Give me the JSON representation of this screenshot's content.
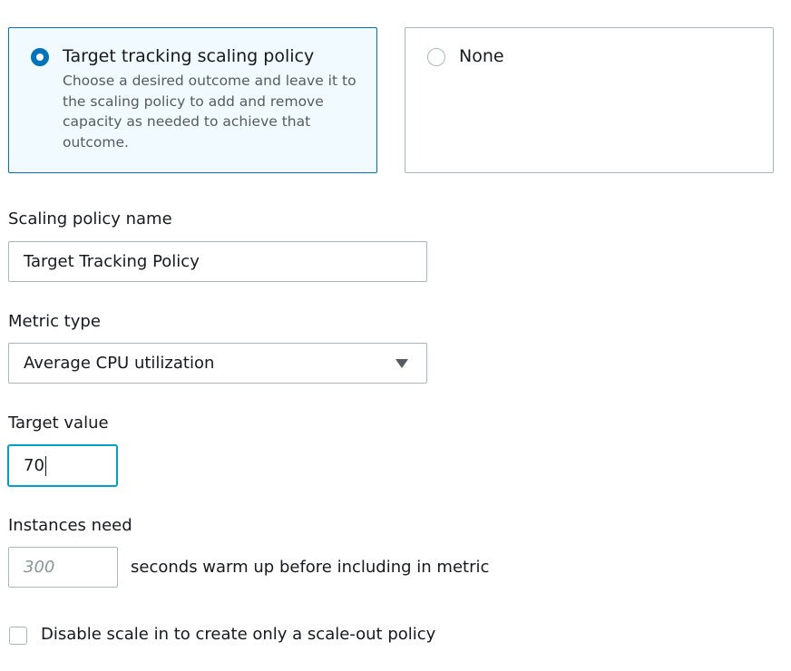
{
  "policy_options": [
    {
      "title": "Target tracking scaling policy",
      "description": "Choose a desired outcome and leave it to the scaling policy to add and remove capacity as needed to achieve that outcome.",
      "selected": true
    },
    {
      "title": "None",
      "selected": false
    }
  ],
  "fields": {
    "policy_name": {
      "label": "Scaling policy name",
      "value": "Target Tracking Policy"
    },
    "metric_type": {
      "label": "Metric type",
      "value": "Average CPU utilization",
      "icon": "caret-down-icon"
    },
    "target_value": {
      "label": "Target value",
      "value": "70"
    },
    "warmup": {
      "label": "Instances need",
      "placeholder": "300",
      "suffix": "seconds warm up before including in metric"
    },
    "disable_scale_in": {
      "label": "Disable scale in to create only a scale-out policy",
      "checked": false
    }
  },
  "colors": {
    "accent": "#0073bb",
    "focus": "#00a1c9",
    "selected_bg": "#f1faff",
    "border": "#aab7b8",
    "muted_text": "#545b64",
    "placeholder_text": "#879596"
  }
}
